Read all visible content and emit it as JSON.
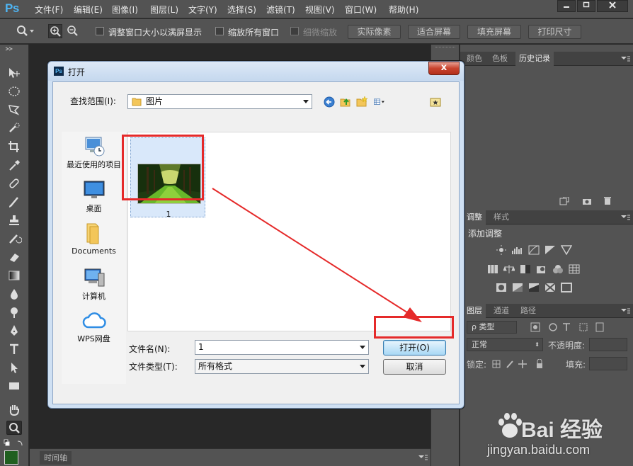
{
  "app": {
    "logo": "Ps"
  },
  "menu": [
    "文件(F)",
    "编辑(E)",
    "图像(I)",
    "图层(L)",
    "文字(Y)",
    "选择(S)",
    "滤镜(T)",
    "视图(V)",
    "窗口(W)",
    "帮助(H)"
  ],
  "window_buttons": [
    "minimize",
    "maximize",
    "close"
  ],
  "options_bar": {
    "resize_windows_label": "调整窗口大小以满屏显示",
    "zoom_all_label": "缩放所有窗口",
    "scrubby_zoom_label": "细微缩放",
    "actual_pixels": "实际像素",
    "fit_screen": "适合屏幕",
    "fill_screen": "填充屏幕",
    "print_size": "打印尺寸"
  },
  "tools": [
    "move-tool",
    "marquee-tool",
    "lasso-tool",
    "quick-selection-tool",
    "crop-tool",
    "eyedropper-tool",
    "healing-brush-tool",
    "brush-tool",
    "clone-stamp-tool",
    "history-brush-tool",
    "eraser-tool",
    "gradient-tool",
    "blur-tool",
    "dodge-tool",
    "pen-tool",
    "type-tool",
    "path-selection-tool",
    "rectangle-tool",
    "hand-tool",
    "zoom-tool"
  ],
  "timeline_tab": "时间轴",
  "panels": {
    "top_tabs": [
      "颜色",
      "色板",
      "历史记录"
    ],
    "top_active": "历史记录",
    "adjust_tabs": [
      "调整",
      "样式"
    ],
    "adjust_active": "调整",
    "adjust_title": "添加调整",
    "layers_tabs": [
      "图层",
      "通道",
      "路径"
    ],
    "layers_active": "图层",
    "layer_filter": "ρ 类型",
    "blend_mode": "正常",
    "opacity_label": "不透明度:",
    "lock_label": "锁定:",
    "fill_label": "填充:"
  },
  "dialog": {
    "title": "打开",
    "close_glyph": "x",
    "look_in_label": "查找范围(I):",
    "look_in_value": "图片",
    "places": [
      "最近使用的项目",
      "桌面",
      "Documents",
      "计算机",
      "WPS网盘"
    ],
    "file_item_name": "1",
    "file_name_label": "文件名(N):",
    "file_name_value": "1",
    "file_type_label": "文件类型(T):",
    "file_type_value": "所有格式",
    "open_button": "打开(O)",
    "cancel_button": "取消"
  },
  "watermark": {
    "text": "Bai 经验",
    "url": "jingyan.baidu.com"
  },
  "colors": {
    "ps_blue": "#4fb4f2",
    "panel_bg": "#535353",
    "workspace_bg": "#282828",
    "annotation_red": "#e52a2a",
    "foreground_swatch": "#1f5f1f",
    "background_swatch": "#ffffff"
  }
}
